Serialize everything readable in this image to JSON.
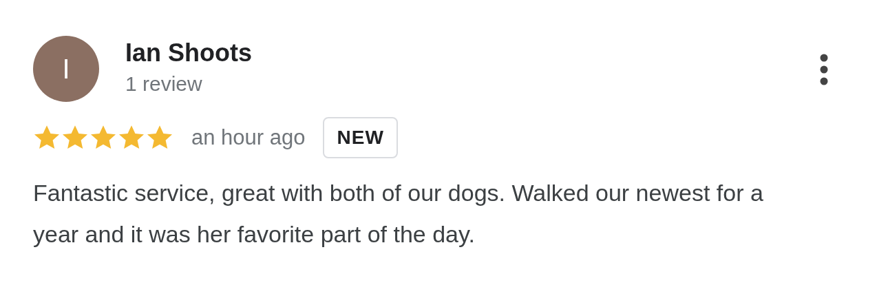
{
  "review": {
    "avatar_letter": "I",
    "author": "Ian Shoots",
    "review_count": "1 review",
    "stars": 5,
    "time": "an hour ago",
    "badge": "NEW",
    "text": "Fantastic service, great with both of our dogs. Walked our newest for a year and it was her favorite part of the day."
  }
}
